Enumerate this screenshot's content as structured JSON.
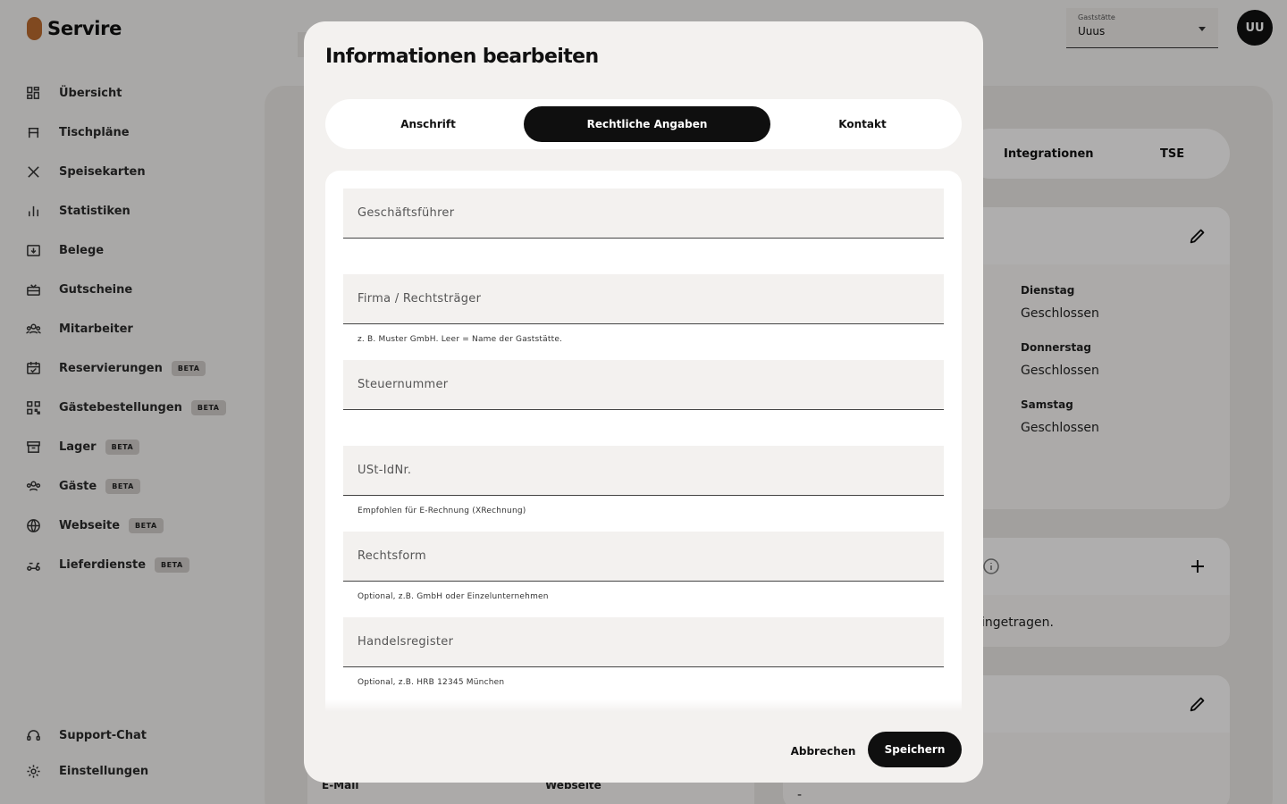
{
  "app": {
    "name": "Servire"
  },
  "sidebar": {
    "items": [
      {
        "label": "Übersicht",
        "icon": "dashboard-icon"
      },
      {
        "label": "Tischpläne",
        "icon": "table-icon"
      },
      {
        "label": "Speisekarten",
        "icon": "cutlery-icon"
      },
      {
        "label": "Statistiken",
        "icon": "bar-chart-icon"
      },
      {
        "label": "Belege",
        "icon": "receipt-icon"
      },
      {
        "label": "Gutscheine",
        "icon": "gift-card-icon"
      },
      {
        "label": "Mitarbeiter",
        "icon": "people-icon"
      },
      {
        "label": "Reservierungen",
        "icon": "calendar-icon",
        "badge": "BETA"
      },
      {
        "label": "Gästebestellungen",
        "icon": "qr-code-icon",
        "badge": "BETA"
      },
      {
        "label": "Lager",
        "icon": "archive-icon",
        "badge": "BETA"
      },
      {
        "label": "Gäste",
        "icon": "guests-icon",
        "badge": "BETA"
      },
      {
        "label": "Webseite",
        "icon": "globe-icon",
        "badge": "BETA"
      },
      {
        "label": "Lieferdienste",
        "icon": "scooter-icon",
        "badge": "BETA"
      }
    ],
    "bottom": [
      {
        "label": "Support-Chat",
        "icon": "headset-icon"
      },
      {
        "label": "Einstellungen",
        "icon": "gear-icon"
      }
    ]
  },
  "header": {
    "gaststaette_label": "Gaststätte",
    "gaststaette_value": "Uuus",
    "avatar_initials": "UU"
  },
  "background": {
    "tabs": [
      "Integrationen",
      "TSE"
    ],
    "hours": [
      {
        "day": "Dienstag",
        "value": "Geschlossen"
      },
      {
        "day": "Donnerstag",
        "value": "Geschlossen"
      },
      {
        "day": "Samstag",
        "value": "Geschlossen"
      }
    ],
    "empty_text": "ingetragen.",
    "dash": "-",
    "email_label": "E-Mail",
    "website_label": "Webseite"
  },
  "modal": {
    "title": "Informationen bearbeiten",
    "tabs": [
      "Anschrift",
      "Rechtliche Angaben",
      "Kontakt"
    ],
    "active_tab": "Rechtliche Angaben",
    "fields": [
      {
        "placeholder": "Geschäftsführer",
        "value": "",
        "hint": ""
      },
      {
        "placeholder": "Firma / Rechtsträger",
        "value": "",
        "hint": "z. B. Muster GmbH. Leer = Name der Gaststätte."
      },
      {
        "placeholder": "Steuernummer",
        "value": "",
        "hint": ""
      },
      {
        "placeholder": "USt-IdNr.",
        "value": "",
        "hint": "Empfohlen für E-Rechnung (XRechnung)"
      },
      {
        "placeholder": "Rechtsform",
        "value": "",
        "hint": "Optional, z.B. GmbH oder Einzelunternehmen"
      },
      {
        "placeholder": "Handelsregister",
        "value": "",
        "hint": "Optional, z.B. HRB 12345 München"
      }
    ],
    "cancel_label": "Abbrechen",
    "save_label": "Speichern"
  }
}
